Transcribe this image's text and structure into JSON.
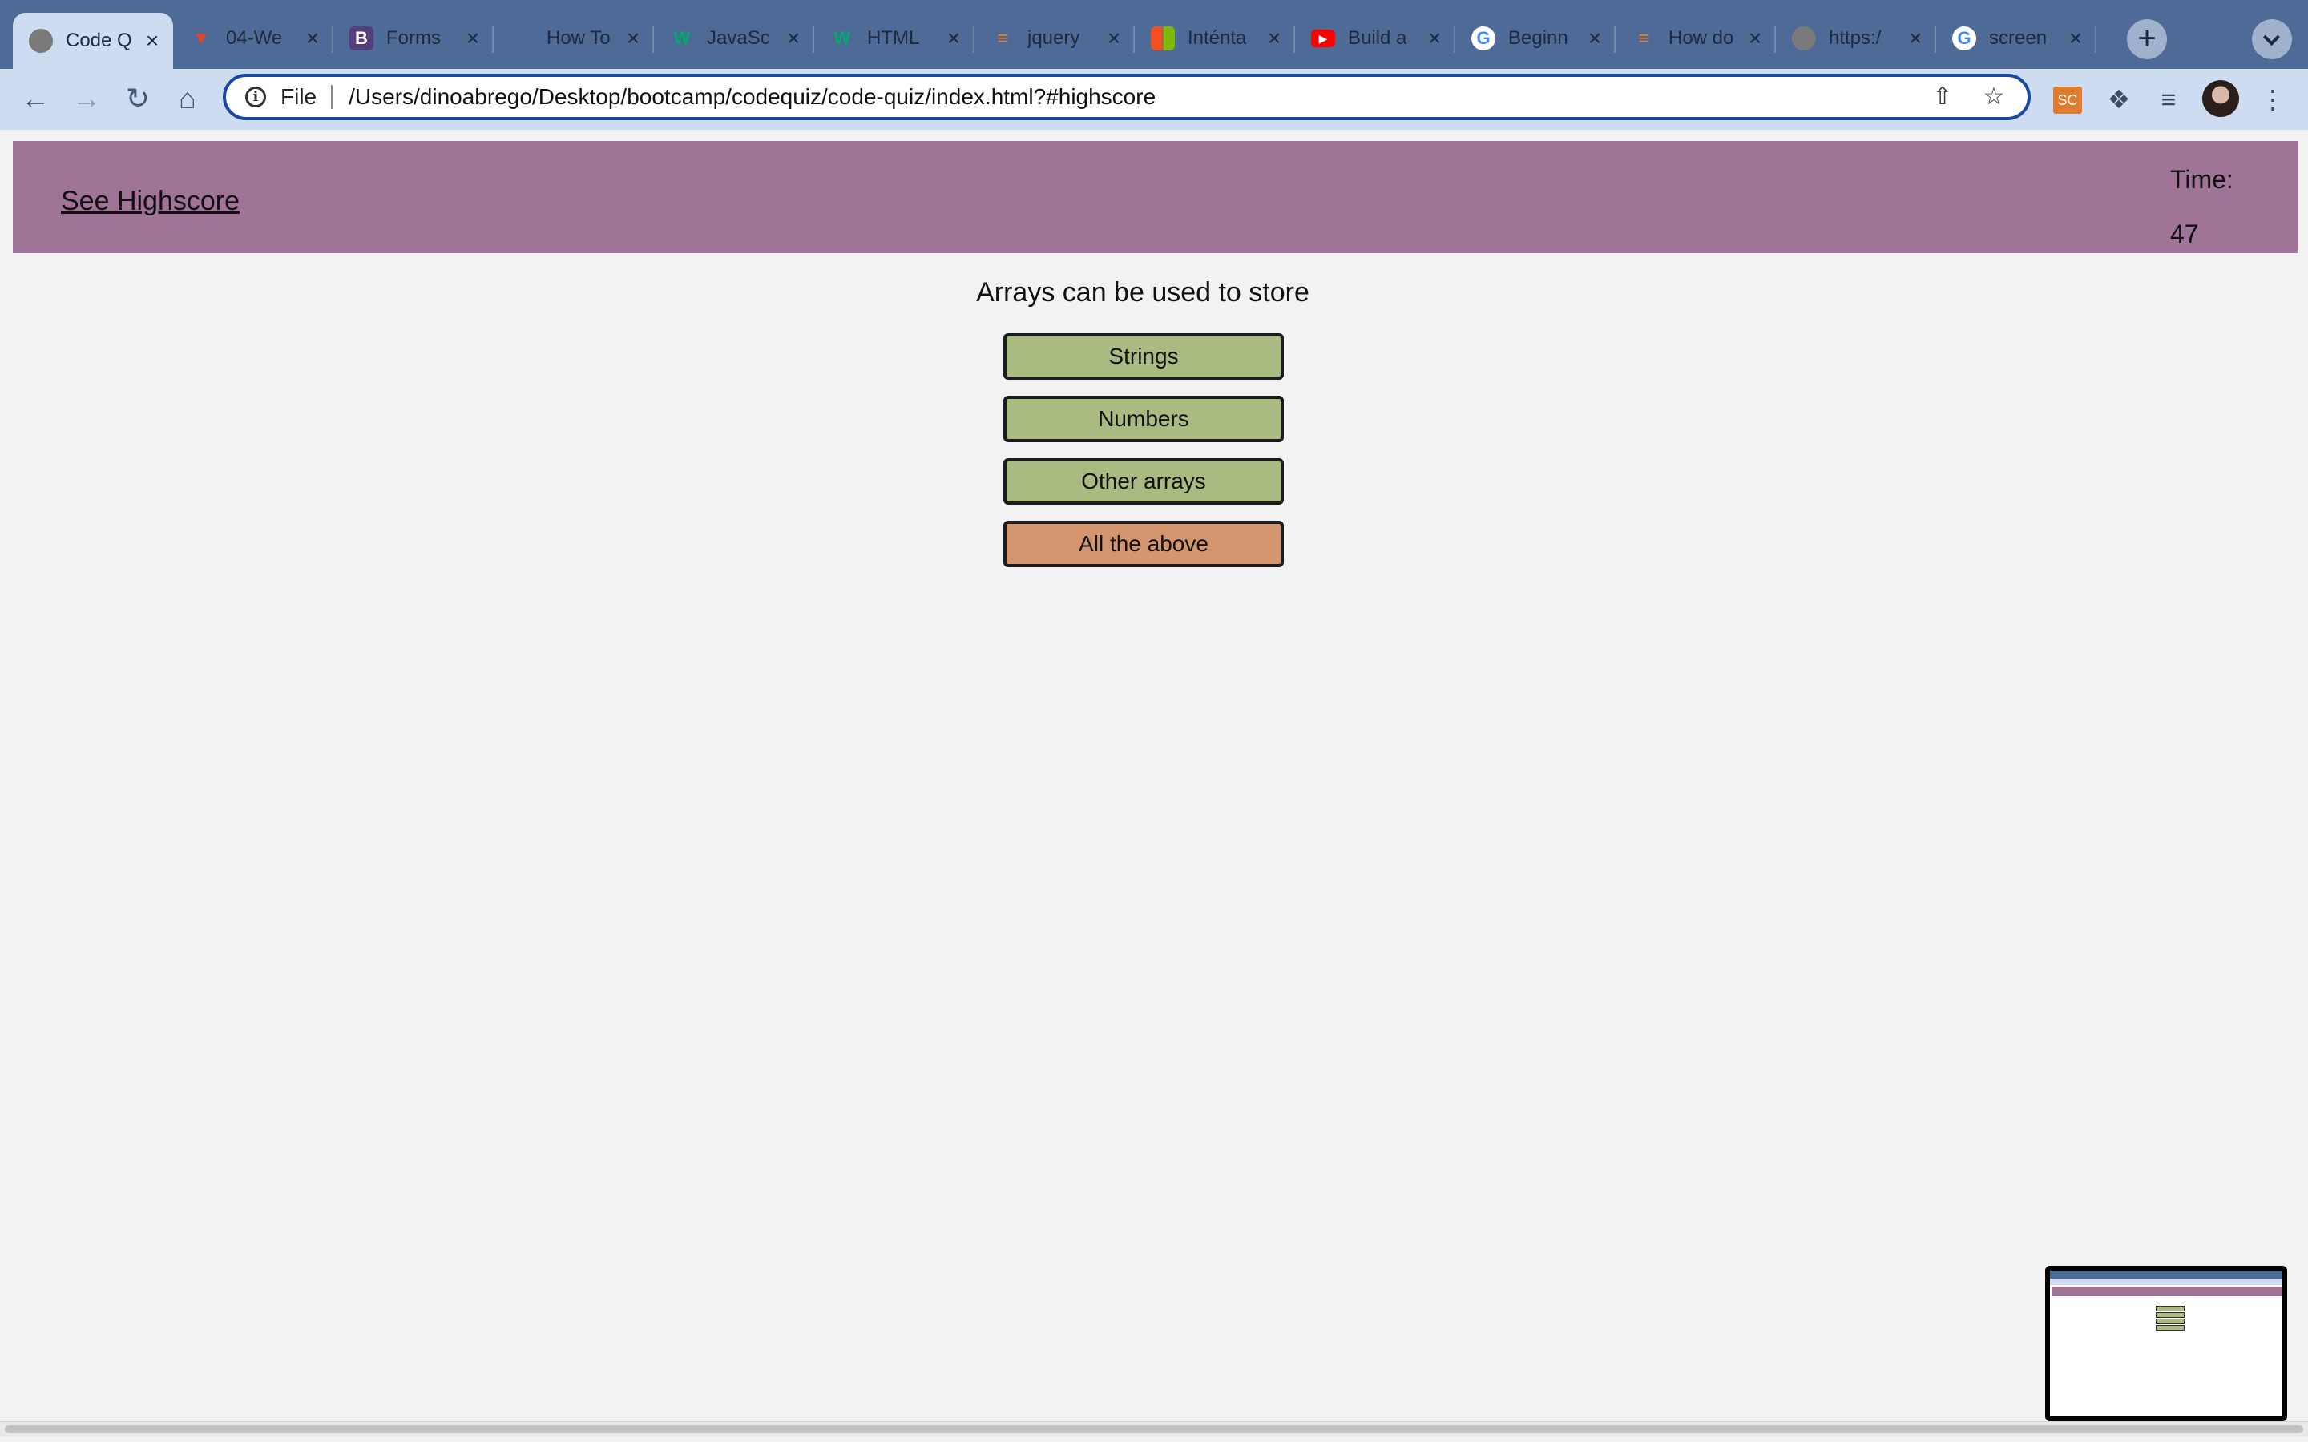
{
  "browser": {
    "tabs": [
      {
        "title": "Code Q",
        "icon": "globe-icon",
        "color": "#7a7a7a",
        "active": true
      },
      {
        "title": "04-We",
        "icon": "gitlab-icon",
        "color": "#e24329"
      },
      {
        "title": "Forms",
        "icon": "bootstrap-icon",
        "color": "#563d7c",
        "glyph": "B"
      },
      {
        "title": "How To",
        "icon": "w3schools-icon",
        "color": "#2e8b57"
      },
      {
        "title": "JavaSc",
        "icon": "w3schools-icon",
        "color": "#04aa6d",
        "glyph": "W"
      },
      {
        "title": "HTML",
        "icon": "w3schools-icon",
        "color": "#04aa6d",
        "glyph": "W"
      },
      {
        "title": "jquery",
        "icon": "stackoverflow-icon",
        "color": "#f48024"
      },
      {
        "title": "Inténta",
        "icon": "microsoft-icon",
        "color": "#f25022"
      },
      {
        "title": "Build a",
        "icon": "youtube-icon",
        "color": "#ff0000"
      },
      {
        "title": "Beginn",
        "icon": "google-icon",
        "color": "#4285f4",
        "glyph": "G"
      },
      {
        "title": "How do",
        "icon": "stackoverflow-icon",
        "color": "#f48024"
      },
      {
        "title": "https:/",
        "icon": "globe-icon",
        "color": "#7a7a7a"
      },
      {
        "title": "screen",
        "icon": "google-icon",
        "color": "#4285f4",
        "glyph": "G"
      }
    ],
    "omnibox": {
      "scheme_label": "File",
      "url": "/Users/dinoabrego/Desktop/bootcamp/codequiz/code-quiz/index.html?#highscore"
    },
    "extension_label": "SC"
  },
  "page": {
    "header": {
      "highscore_link": "See Highscore",
      "time_label": "Time:",
      "time_value": "47"
    },
    "quiz": {
      "question": "Arrays can be used to store",
      "answers": [
        {
          "label": "Strings",
          "selected": false
        },
        {
          "label": "Numbers",
          "selected": false
        },
        {
          "label": "Other arrays",
          "selected": false
        },
        {
          "label": "All the above",
          "selected": true
        }
      ]
    }
  }
}
